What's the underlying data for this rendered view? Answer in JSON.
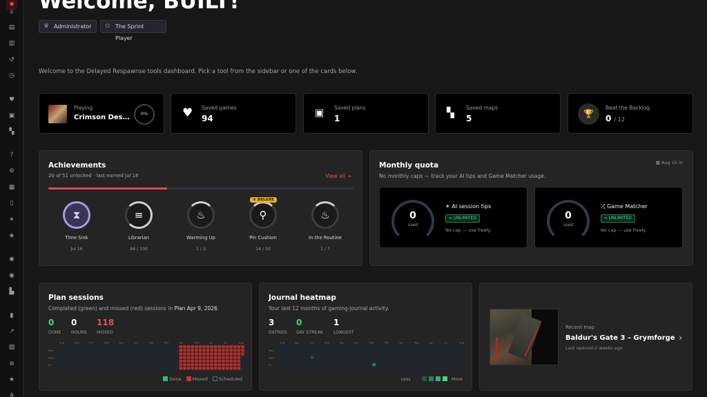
{
  "header": {
    "welcome": "Welcome, BUILT!",
    "roles": [
      {
        "label": "Administrator",
        "icon": "crown-icon"
      },
      {
        "label": "The Sprint Player",
        "icon": "gamepad-icon"
      }
    ],
    "intro": "Welcome to the Delayed Respawnse tools dashboard. Pick a tool from the sidebar or one of the cards below."
  },
  "sidebar": {
    "icons": [
      "dashboard-icon",
      "trophy-icon",
      "database-icon",
      "document-icon",
      "history-icon",
      "alarm-icon",
      "heart-icon",
      "calendar-check-icon",
      "map-icon",
      "help-icon",
      "gamepad-icon",
      "calendar-icon",
      "book-icon",
      "wand-icon",
      "puzzle-icon",
      "bug-icon",
      "disc-icon",
      "map-pin-icon",
      "bar-chart-icon",
      "line-chart-icon",
      "image-icon",
      "controller-icon",
      "star-icon",
      "network-icon"
    ]
  },
  "stats": {
    "playing": {
      "label": "Playing",
      "title": "Crimson Des…",
      "percent": "0%"
    },
    "saved_games": {
      "label": "Saved games",
      "value": "94"
    },
    "saved_plans": {
      "label": "Saved plans",
      "value": "1"
    },
    "saved_maps": {
      "label": "Saved maps",
      "value": "5"
    },
    "backlog": {
      "label": "Beat the Backlog",
      "value": "0",
      "total": "/ 12"
    }
  },
  "achievements": {
    "title": "Achievements",
    "subtitle": "20 of 51 unlocked · last earned Jul 16",
    "view_all": "View all →",
    "progress_fraction": 0.39,
    "items": [
      {
        "name": "Time Sink",
        "progress": "Jul 16",
        "icon": "hourglass-icon",
        "earned": true
      },
      {
        "name": "Librarian",
        "progress": "94 / 100",
        "icon": "database-icon",
        "fill": 0.94
      },
      {
        "name": "Warming Up",
        "progress": "1 / 3",
        "icon": "flame-icon",
        "fill": 0.33
      },
      {
        "name": "Pin Cushion",
        "progress": "14 / 50",
        "icon": "pin-icon",
        "fill": 0.28,
        "badge": "DELUXE"
      },
      {
        "name": "In the Routine",
        "progress": "1 / 7",
        "icon": "flame-icon",
        "fill": 0.14
      }
    ]
  },
  "quota": {
    "title": "Monthly quota",
    "subtitle": "No monthly caps — track your AI tips and Game Matcher usage.",
    "date": "Aug 15 in",
    "cards": [
      {
        "title": "AI session tips",
        "value": "0",
        "unit": "used",
        "badge": "∞ UNLIMITED",
        "note": "No cap — use freely.",
        "icon": "wand-icon"
      },
      {
        "title": "Game Matcher",
        "value": "0",
        "unit": "used",
        "badge": "∞ UNLIMITED",
        "note": "No cap — use freely.",
        "icon": "shuffle-icon"
      }
    ]
  },
  "plan_sessions": {
    "title": "Plan sessions",
    "subtitle_pre": "Completed (green) and missed (red) sessions in",
    "plan_name": "Plan Apr 9, 2026",
    "stats": [
      {
        "value": "0",
        "label": "DONE",
        "color": "#3ddc84"
      },
      {
        "value": "0",
        "label": "HOURS",
        "color": "#ffffff"
      },
      {
        "value": "118",
        "label": "MISSED",
        "color": "#e05252"
      }
    ],
    "legend": [
      "Done",
      "Missed",
      "Scheduled"
    ],
    "months": [
      "Aug",
      "Sep",
      "Oct",
      "Nov",
      "Dec",
      "Jan",
      "Feb",
      "Mar",
      "Apr",
      "May",
      "Jun",
      "Jul",
      "Aug"
    ],
    "days": [
      "Mon",
      "Wed",
      "Fri"
    ]
  },
  "journal": {
    "title": "Journal heatmap",
    "subtitle": "Your last 12 months of gaming-journal activity.",
    "stats": [
      {
        "value": "3",
        "label": "ENTRIES",
        "color": "#ffffff"
      },
      {
        "value": "0",
        "label": "DAY STREAK",
        "color": "#3ddc84"
      },
      {
        "value": "1",
        "label": "LONGEST",
        "color": "#ffffff"
      }
    ],
    "legend_less": "Less",
    "legend_more": "More",
    "months": [
      "Aug",
      "Sep",
      "Oct",
      "Nov",
      "Dec",
      "Jan",
      "Feb",
      "Mar",
      "Apr",
      "May",
      "Jun",
      "Jul",
      "Aug"
    ],
    "days": [
      "Mon",
      "Wed",
      "Fri"
    ]
  },
  "recent_map": {
    "label": "Recent map",
    "title": "Baldur's Gate 3 – Grymforge",
    "meta": "Last opened 2 weeks ago"
  },
  "colors": {
    "accent": "#e05252",
    "green": "#3ddc84",
    "bg": "#171717",
    "panel": "#242424"
  }
}
